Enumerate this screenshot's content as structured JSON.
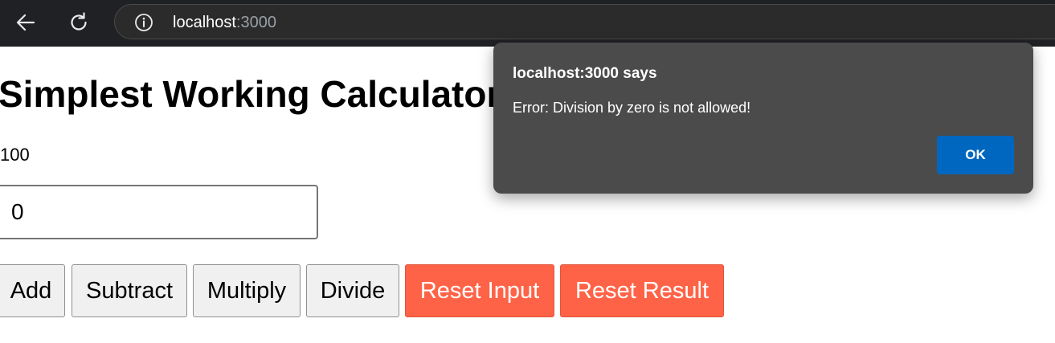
{
  "browser": {
    "url_host": "localhost",
    "url_port": ":3000",
    "icons": {
      "back": "back-arrow-icon",
      "reload": "reload-icon",
      "info": "info-icon"
    }
  },
  "page": {
    "title": "Simplest Working Calculator",
    "result": "100",
    "input_value": "0",
    "buttons": {
      "add": "Add",
      "subtract": "Subtract",
      "multiply": "Multiply",
      "divide": "Divide",
      "reset_input": "Reset Input",
      "reset_result": "Reset Result"
    },
    "colors": {
      "reset_button": "#ff6347",
      "default_button": "#f0f0f0"
    }
  },
  "dialog": {
    "title": "localhost:3000 says",
    "message": "Error: Division by zero is not allowed!",
    "ok_label": "OK",
    "colors": {
      "background": "#4b4b4b",
      "ok_button": "#0067c0"
    }
  }
}
